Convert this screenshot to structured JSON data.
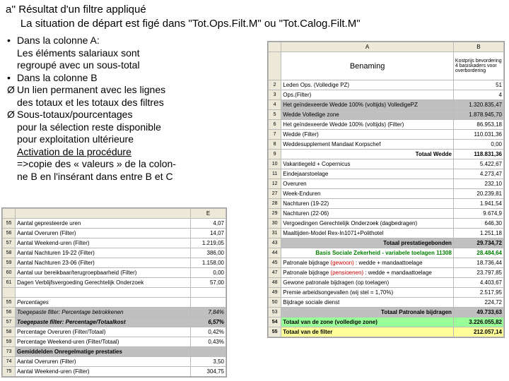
{
  "header": {
    "line1": "a''  Résultat d'un filtre appliqué",
    "line2": "     La situation de départ est figé dans \"Tot.Ops.Filt.M\" ou \"Tot.Calog.Filt.M\""
  },
  "bullets": [
    {
      "t": "bul",
      "lines": [
        "Dans la colonne A:",
        "Les éléments salariaux sont",
        "regroupé avec un sous-total"
      ]
    },
    {
      "t": "bul",
      "lines": [
        "Dans la colonne B"
      ]
    },
    {
      "t": "arr",
      "lines": [
        "Un lien permanent avec les lignes",
        "des totaux  et les totaux des filtres"
      ]
    },
    {
      "t": "arr",
      "lines": [
        "Sous-totaux/pourcentages",
        "pour la sélection reste disponible",
        "pour exploitation ultérieure",
        "<u>Activation de la procédure</u>",
        "=>copie des « valeurs » de la colon-",
        "ne B en l'insérant dans entre B et C"
      ]
    }
  ],
  "topTable": {
    "cols": [
      "",
      "A",
      "B"
    ],
    "headerRow": {
      "a": "Benaming",
      "b": "Kostprijs bevordering 4 basiskaders voor overbordering"
    },
    "rows": [
      {
        "r": "2",
        "a": "Leden Ops. (Volledige PZ)",
        "b": "51"
      },
      {
        "r": "3",
        "a": "Ops.(Filter)",
        "b": "4"
      },
      {
        "r": "4",
        "a": "Het geïndexeerde Wedde 100% (voltijds) VolledigePZ",
        "b": "1.320.835,47",
        "gray": 1
      },
      {
        "r": "5",
        "a": "Wedde Volledige zone",
        "b": "1.878.945,70",
        "gray": 1
      },
      {
        "r": "6",
        "a": "Het geïndexeerde Wedde 100% (voltijds) (Filter)",
        "b": "86.953,18"
      },
      {
        "r": "7",
        "a": "Wedde (Filter)",
        "b": "110.031,36"
      },
      {
        "r": "8",
        "a": "Weddesupplement Mandaat Korpschef",
        "b": "0,00"
      },
      {
        "r": "9",
        "a": "Totaal Wedde",
        "b": "118.831,36",
        "bold": 1,
        "rightAlignA": 1
      },
      {
        "r": "10",
        "a": "Vakantiegeld + Copernicus",
        "b": "5.422,67"
      },
      {
        "r": "11",
        "a": "Eindejaarstoelage",
        "b": "4.273,47"
      },
      {
        "r": "12",
        "a": "Overuren",
        "b": "232,10"
      },
      {
        "r": "27",
        "a": "Week-Enduren",
        "b": "20.239,81"
      },
      {
        "r": "28",
        "a": "Nachturen (19-22)",
        "b": "1.941,54"
      },
      {
        "r": "29",
        "a": "Nachturen (22-06)",
        "b": "9.674,9"
      },
      {
        "r": "30",
        "a": "Vergoedingen Gerechtelijk Onderzoek (dagbedragen)",
        "b": "646,30"
      },
      {
        "r": "31",
        "a": "Maaltijden-Model Rex-In1071+Polithotel",
        "b": "1.251,18"
      },
      {
        "r": "43",
        "a": "Totaal prestatiegebonden",
        "b": "29.734,72",
        "bold": 1,
        "rightAlignA": 1,
        "gray": 1
      },
      {
        "r": "44",
        "a": "Basis Sociale Zekerheid - variabele toelagen 11308",
        "b": "28.484,64",
        "green": 1,
        "bold": 1,
        "rightAlignA": 1
      },
      {
        "r": "45",
        "a": "Patronale bijdrage (gewoon) : wedde + mandaattoelage",
        "b": "18.736,44",
        "redpart": "(gewoon)"
      },
      {
        "r": "47",
        "a": "Patronale bijdrage (pensioenen) : wedde + mandaattoelage",
        "b": "23.797,85",
        "redpart": "(pensioenen)"
      },
      {
        "r": "48",
        "a": "Gewone patronale bijdragen (op toelagen)",
        "b": "4.403,67"
      },
      {
        "r": "49",
        "a": "Premie arbeidsongevallen (wij stel = 1,70%)",
        "b": "2.517,95"
      },
      {
        "r": "50",
        "a": "Bijdrage sociale dienst",
        "b": "224,72"
      },
      {
        "r": "53",
        "a": "Totaal Patronale bijdragen",
        "b": "49.733,63",
        "bold": 1,
        "rightAlignA": 1,
        "gray": 1
      },
      {
        "r": "54",
        "a": "Totaal van de zone (volledige zone)",
        "b": "3.226.055,82",
        "bggreen": 1
      },
      {
        "r": "55",
        "a": "Totaal van de filter",
        "b": "212.057,14",
        "bgyellow": 1,
        "bold": 1
      }
    ]
  },
  "leftTable": {
    "cols": [
      "",
      "E"
    ],
    "rows": [
      {
        "r": "55",
        "a": "Aantal gepresteerde uren",
        "b": "4,07"
      },
      {
        "r": "56",
        "a": "Aantal Overuren (Filter)",
        "b": "14,07"
      },
      {
        "r": "57",
        "a": "Aantal Weekend-uren (Filter)",
        "b": "1.219,05"
      },
      {
        "r": "58",
        "a": "Aantal Nachturen 19-22 (Filter)",
        "b": "386,00"
      },
      {
        "r": "59",
        "a": "Aantal Nachturen 23-06 (Filter)",
        "b": "1.158,00"
      },
      {
        "r": "60",
        "a": "Aantal uur bereikbaar/terugroepbaarheid (Filter)",
        "b": "0,00"
      },
      {
        "r": "61",
        "a": "Dagen Verblijfsvergoeding Gerechtelijk Onderzoek",
        "b": "57,00"
      },
      {
        "r": "",
        "a": "",
        "b": ""
      },
      {
        "r": "55",
        "a": "Percentages",
        "b": "",
        "italic": 1
      },
      {
        "r": "56",
        "a": "Toegepaste filter: Percentage betrokkenen",
        "b": "7,84%",
        "italic": 1,
        "gray": 1
      },
      {
        "r": "57",
        "a": "Toegepaste filter: Percentage/Totaalkost",
        "b": "6,57%",
        "bold": 1,
        "italic": 1,
        "gray": 1
      },
      {
        "r": "58",
        "a": "Percentage Overuren (Filter/Totaal)",
        "b": "0,42%"
      },
      {
        "r": "59",
        "a": "Percentage Weekend-uren (Filter/Totaal)",
        "b": "0,43%"
      },
      {
        "r": "73",
        "a": "Gemiddelden Onregelmatige prestaties",
        "b": "",
        "bold": 1,
        "gray": 1
      },
      {
        "r": "74",
        "a": "Aantal Overuren (Filter)",
        "b": "3,50"
      },
      {
        "r": "75",
        "a": "Aantal Weekend-uren (Filter)",
        "b": "304,75"
      }
    ]
  }
}
